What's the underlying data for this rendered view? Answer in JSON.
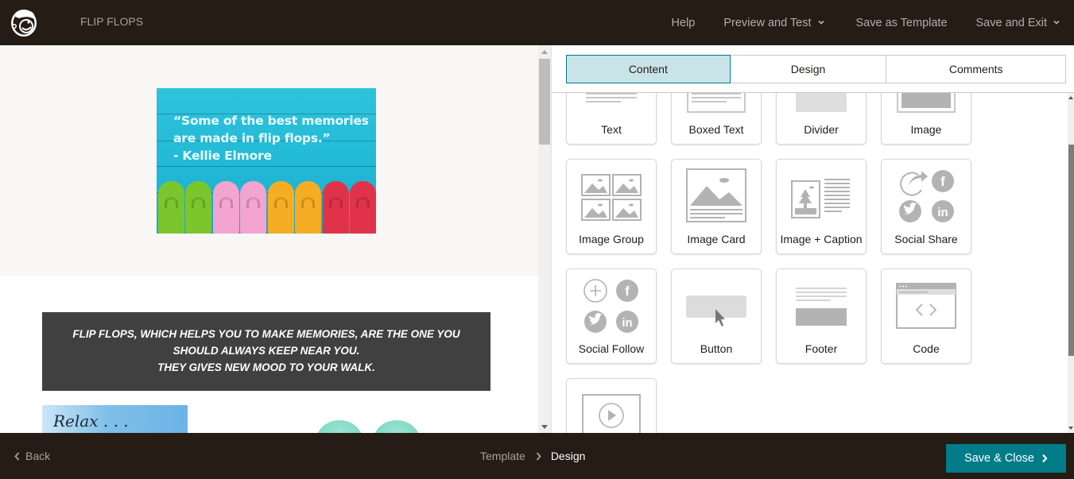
{
  "header": {
    "logo": "mailchimp-freddie-logo",
    "campaign_title": "FLIP FLOPS",
    "nav": {
      "help": "Help",
      "preview_and_test": "Preview and Test",
      "save_as_template": "Save as Template",
      "save_and_exit": "Save and Exit"
    }
  },
  "preview": {
    "hero_image": {
      "quote_line1": "“Some of the best memories",
      "quote_line2": "are made in flip flops.”",
      "quote_line3": "- Kellie Elmore",
      "flipflop_colors": [
        "#7bc62d",
        "#f3a4cf",
        "#f6ad24",
        "#e0334a"
      ]
    },
    "text_block": {
      "line1": "FLIP FLOPS, WHICH HELPS YOU TO MAKE MEMORIES, ARE THE ONE YOU",
      "line2": "SHOULD ALWAYS KEEP NEAR YOU.",
      "line3": "THEY GIVES NEW MOOD TO YOUR WALK."
    },
    "relax_image": {
      "text": "Relax . . ."
    }
  },
  "editor": {
    "tabs": [
      {
        "label": "Content",
        "active": true
      },
      {
        "label": "Design",
        "active": false
      },
      {
        "label": "Comments",
        "active": false
      }
    ],
    "blocks": [
      {
        "label": "Text",
        "icon": "text-block-icon"
      },
      {
        "label": "Boxed Text",
        "icon": "boxed-text-icon"
      },
      {
        "label": "Divider",
        "icon": "divider-icon"
      },
      {
        "label": "Image",
        "icon": "image-icon"
      },
      {
        "label": "Image Group",
        "icon": "image-group-icon"
      },
      {
        "label": "Image Card",
        "icon": "image-card-icon"
      },
      {
        "label": "Image + Caption",
        "icon": "image-caption-icon"
      },
      {
        "label": "Social Share",
        "icon": "social-share-icon"
      },
      {
        "label": "Social Follow",
        "icon": "social-follow-icon"
      },
      {
        "label": "Button",
        "icon": "button-block-icon"
      },
      {
        "label": "Footer",
        "icon": "footer-icon"
      },
      {
        "label": "Code",
        "icon": "code-icon"
      },
      {
        "label": "Video",
        "icon": "video-icon"
      }
    ]
  },
  "footer": {
    "back": "Back",
    "breadcrumb": {
      "step1": "Template",
      "step2": "Design"
    },
    "save_close": "Save & Close"
  },
  "colors": {
    "topbar_bg": "#241c15",
    "accent_teal": "#007c89",
    "active_tab_bg": "#c9e4e8",
    "text_block_bg": "#404040"
  }
}
